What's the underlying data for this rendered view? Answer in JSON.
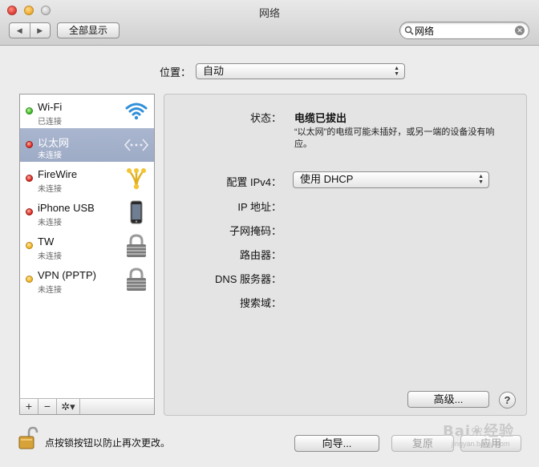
{
  "window": {
    "title": "网络"
  },
  "toolbar": {
    "back_label": "◀",
    "forward_label": "▶",
    "show_all_label": "全部显示"
  },
  "search": {
    "value": "网络"
  },
  "location": {
    "label": "位置：",
    "value": "自动"
  },
  "services": [
    {
      "name": "Wi-Fi",
      "status": "已连接",
      "dot": "green",
      "icon": "wifi-icon",
      "selected": false
    },
    {
      "name": "以太网",
      "status": "未连接",
      "dot": "red",
      "icon": "ethernet-icon",
      "selected": true
    },
    {
      "name": "FireWire",
      "status": "未连接",
      "dot": "red",
      "icon": "firewire-icon",
      "selected": false
    },
    {
      "name": "iPhone USB",
      "status": "未连接",
      "dot": "red",
      "icon": "iphone-icon",
      "selected": false
    },
    {
      "name": "TW",
      "status": "未连接",
      "dot": "yellow",
      "icon": "vpn-lock-icon",
      "selected": false
    },
    {
      "name": "VPN (PPTP)",
      "status": "未连接",
      "dot": "yellow",
      "icon": "vpn-lock-icon",
      "selected": false
    }
  ],
  "sidebar_buttons": {
    "add": "+",
    "remove": "−",
    "gear": "✲▾"
  },
  "detail": {
    "status_label": "状态：",
    "status_value": "电缆已拔出",
    "status_desc": "“以太网”的电缆可能未插好，或另一端的设备没有响应。",
    "ipv4_label": "配置 IPv4：",
    "ipv4_value": "使用 DHCP",
    "ip_label": "IP 地址：",
    "subnet_label": "子网掩码：",
    "router_label": "路由器：",
    "dns_label": "DNS 服务器：",
    "search_domain_label": "搜索域：",
    "advanced_label": "高级...",
    "help_label": "?"
  },
  "footer": {
    "lock_text": "点按锁按钮以防止再次更改。",
    "assist_label": "向导...",
    "revert_label": "复原",
    "apply_label": "应用"
  },
  "watermark": {
    "text": "Bai❀经验",
    "sub": "jingyan.baidu.com"
  },
  "colors": {
    "selection": "#a3afca",
    "status_green": "#3bb524",
    "status_red": "#d8281e",
    "status_yellow": "#f0b323"
  }
}
